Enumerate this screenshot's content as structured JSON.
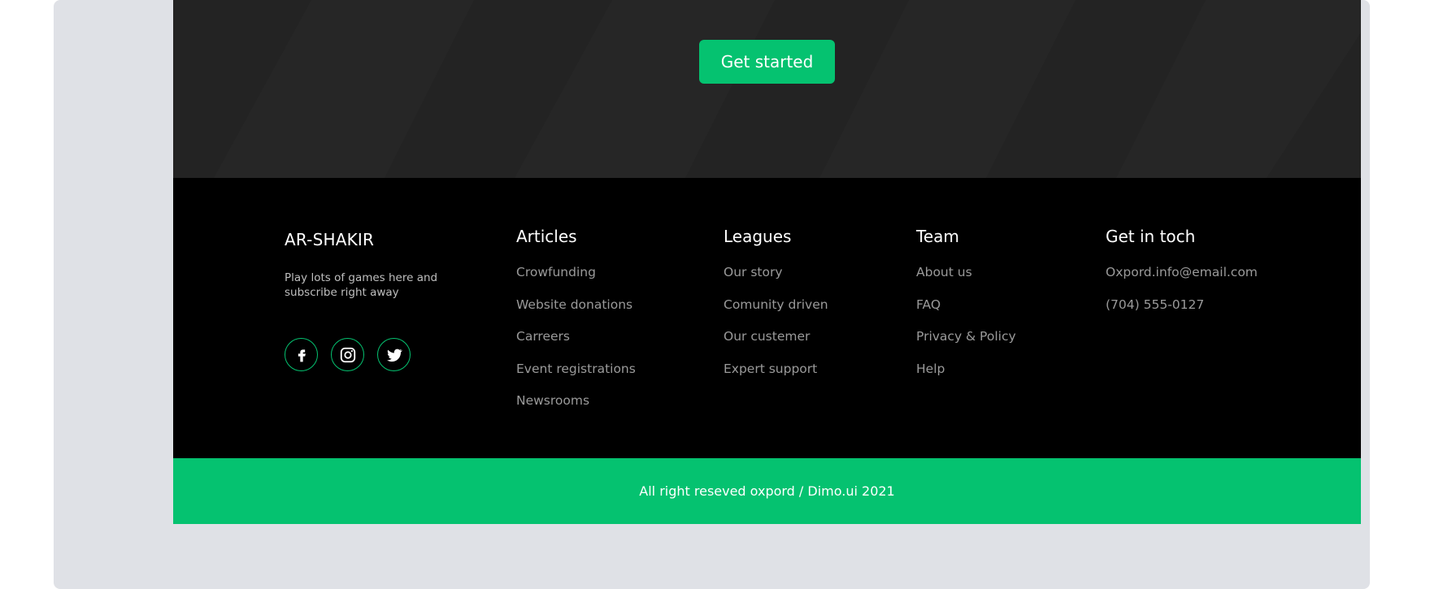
{
  "cta": {
    "button_label": "Get started"
  },
  "footer": {
    "brand": "AR-SHAKIR",
    "tagline": "Play lots of games here and subscribe right away",
    "socials": [
      {
        "name": "facebook-icon"
      },
      {
        "name": "instagram-icon"
      },
      {
        "name": "twitter-icon"
      }
    ],
    "columns": {
      "articles": {
        "title": "Articles",
        "items": [
          "Crowfunding",
          "Website donations",
          "Carreers",
          "Event registrations",
          "Newsrooms"
        ]
      },
      "leagues": {
        "title": "Leagues",
        "items": [
          "Our story",
          "Comunity driven",
          "Our custemer",
          "Expert support"
        ]
      },
      "team": {
        "title": "Team",
        "items": [
          "About us",
          "FAQ",
          "Privacy & Policy",
          "Help"
        ]
      },
      "contact": {
        "title": "Get in toch",
        "items": [
          "Oxpord.info@email.com",
          "(704) 555-0127"
        ]
      }
    }
  },
  "bottom_bar": {
    "copyright": "All right reseved oxpord / Dimo.ui 2021"
  },
  "colors": {
    "accent": "#05c270",
    "frame": "#dfe1e6",
    "cta_band": "#232323",
    "footer": "#000000"
  }
}
